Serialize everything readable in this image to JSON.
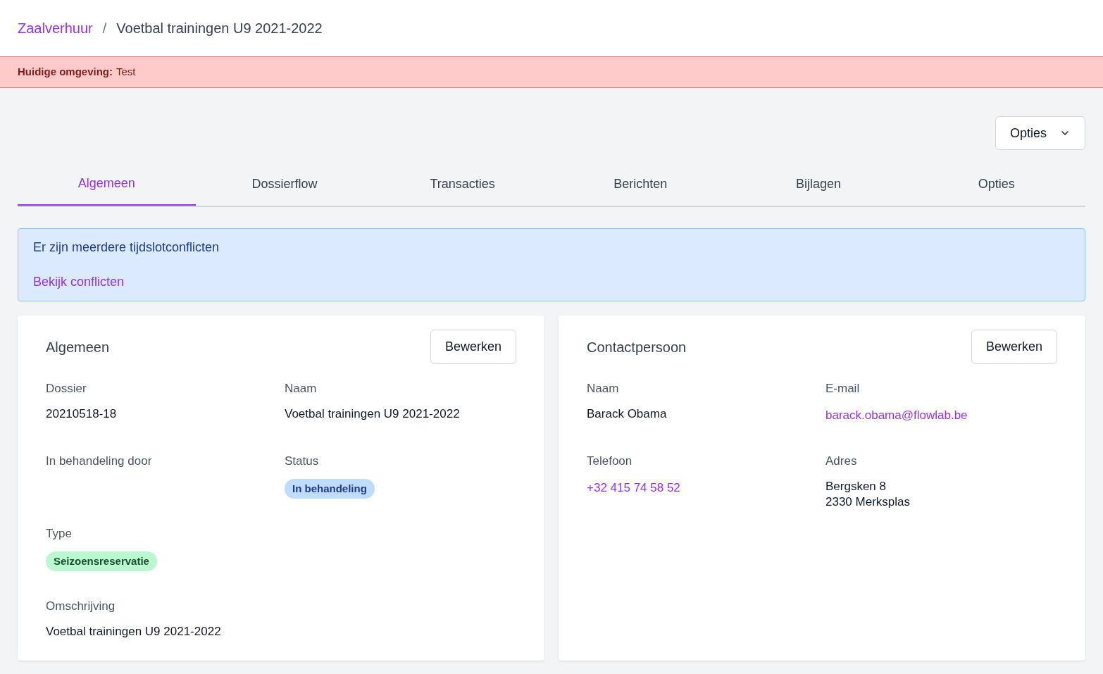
{
  "breadcrumb": [
    {
      "label": "Zaalverhuur",
      "kind": "link"
    },
    {
      "label": "/",
      "kind": "separator"
    },
    {
      "label": "Voetbal trainingen U9 2021-2022",
      "kind": "current"
    }
  ],
  "environment_banner": {
    "label": "Huidige omgeving:",
    "value": "Test"
  },
  "options_button": {
    "label": "Opties"
  },
  "tabs": [
    {
      "label": "Algemeen",
      "selected": true
    },
    {
      "label": "Dossierflow",
      "selected": false
    },
    {
      "label": "Transacties",
      "selected": false
    },
    {
      "label": "Berichten",
      "selected": false
    },
    {
      "label": "Bijlagen",
      "selected": false
    },
    {
      "label": "Opties",
      "selected": false
    }
  ],
  "alert": {
    "message": "Er zijn meerdere tijdslotconflicten",
    "link": "Bekijk conflicten"
  },
  "cards": [
    {
      "title": "Algemeen",
      "button": "Bewerken",
      "fields": [
        {
          "label": "Dossier",
          "kind": "text",
          "lines": [
            "20210518-18"
          ]
        },
        {
          "label": "Naam",
          "kind": "text",
          "lines": [
            "Voetbal trainingen U9 2021-2022"
          ]
        },
        {
          "label": "In behandeling door",
          "kind": "text"
        },
        {
          "label": "Status",
          "kind": "badge",
          "lines": [
            "In behandeling"
          ],
          "color": "#bfdbfe"
        },
        {
          "label": "Type",
          "kind": "badge",
          "lines": [
            "Seizoensreservatie"
          ],
          "color": "#bbf7d0"
        },
        {
          "label": "Omschrijving",
          "kind": "wide",
          "lines": [
            "Voetbal trainingen U9 2021-2022"
          ]
        }
      ]
    },
    {
      "title": "Contactpersoon",
      "button": "Bewerken",
      "fields": [
        {
          "label": "Naam",
          "kind": "text",
          "lines": [
            "Barack Obama"
          ]
        },
        {
          "label": "E-mail",
          "kind": "link",
          "lines": [
            "barack.obama@flowlab.be"
          ]
        },
        {
          "label": "Telefoon",
          "kind": "link",
          "lines": [
            "+32 415 74 58 52"
          ]
        },
        {
          "label": "Adres",
          "kind": "text",
          "lines": [
            "Bergsken 8",
            "2330 Merksplas"
          ]
        }
      ]
    }
  ]
}
